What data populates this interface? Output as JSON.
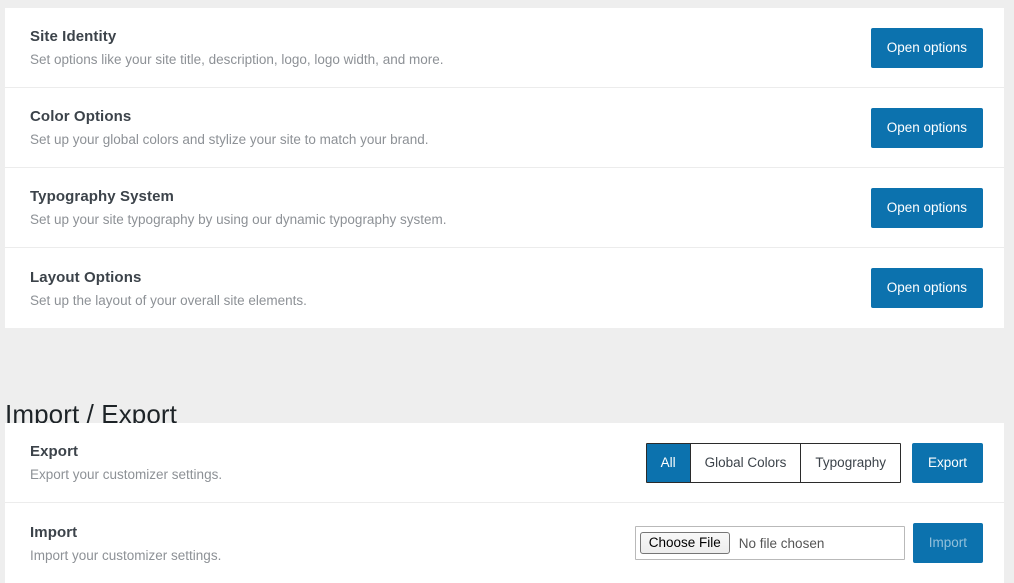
{
  "theme": {
    "accent": "#0c72ae",
    "page_bg": "#eeeeee",
    "card_bg": "#ffffff",
    "title_color": "#3c434a",
    "desc_color": "#8d9196",
    "divider": "#ececec"
  },
  "options_card": {
    "rows": [
      {
        "title": "Site Identity",
        "desc": "Set options like your site title, description, logo, logo width, and more.",
        "button": "Open options"
      },
      {
        "title": "Color Options",
        "desc": "Set up your global colors and stylize your site to match your brand.",
        "button": "Open options"
      },
      {
        "title": "Typography System",
        "desc": "Set up your site typography by using our dynamic typography system.",
        "button": "Open options"
      },
      {
        "title": "Layout Options",
        "desc": "Set up the layout of your overall site elements.",
        "button": "Open options"
      }
    ]
  },
  "import_export": {
    "heading": "Import / Export",
    "export_row": {
      "title": "Export",
      "desc": "Export your customizer settings.",
      "segments": [
        {
          "label": "All",
          "selected": true
        },
        {
          "label": "Global Colors",
          "selected": false
        },
        {
          "label": "Typography",
          "selected": false
        }
      ],
      "action_button": "Export"
    },
    "import_row": {
      "title": "Import",
      "desc": "Import your customizer settings.",
      "choose_file_label": "Choose File",
      "file_name": "No file chosen",
      "action_button": "Import",
      "action_disabled": true
    }
  }
}
